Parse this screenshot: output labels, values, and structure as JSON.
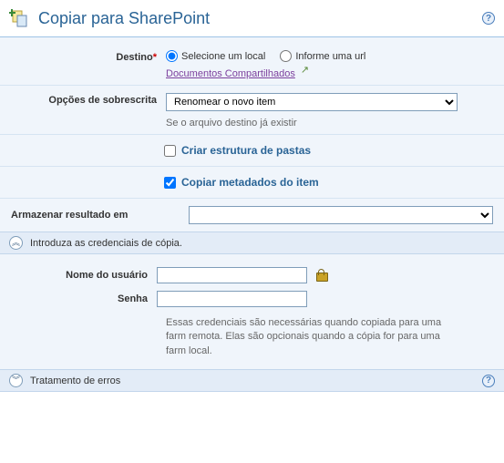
{
  "header": {
    "title": "Copiar para SharePoint"
  },
  "destination": {
    "label": "Destino",
    "option_select_label": "Selecione um local",
    "option_url_label": "Informe uma url",
    "link_text": "Documentos Compartilhados"
  },
  "overwrite": {
    "label": "Opções de sobrescrita",
    "selected": "Renomear o novo item",
    "hint": "Se o arquivo destino já existir"
  },
  "folder_structure": {
    "label": "Criar estrutura de pastas"
  },
  "copy_metadata": {
    "label": "Copiar metadados do item"
  },
  "store_result": {
    "label": "Armazenar resultado em",
    "value": ""
  },
  "credentials_section": {
    "title": "Introduza as credenciais de cópia.",
    "username_label": "Nome do usuário",
    "password_label": "Senha",
    "hint": "Essas credenciais são necessárias quando copiada para uma farm remota. Elas são opcionais quando a cópia for para uma farm local."
  },
  "error_section": {
    "title": "Tratamento de erros"
  }
}
